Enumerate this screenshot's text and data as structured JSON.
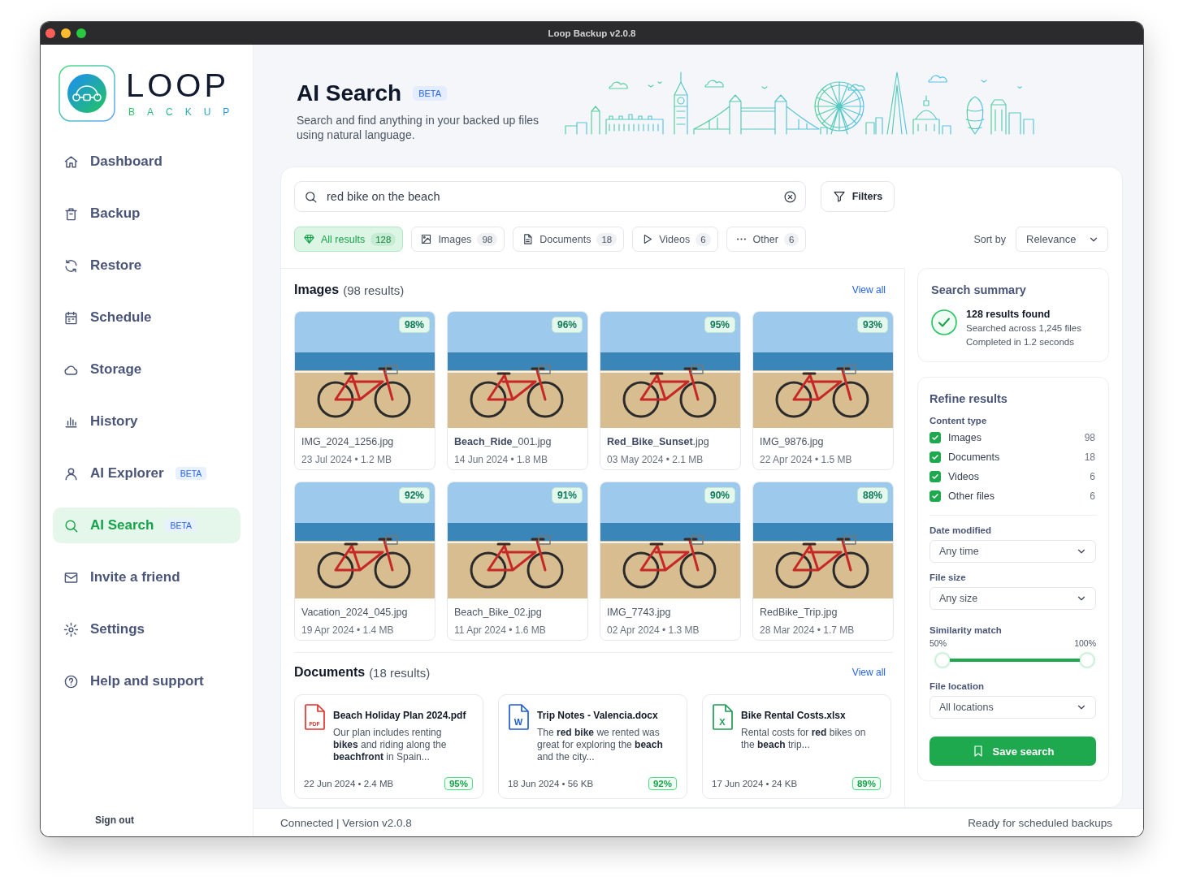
{
  "window": {
    "title": "Loop Backup v2.0.8"
  },
  "brand": {
    "name": "LOOP",
    "tagline": "BACKUP"
  },
  "sidebar": {
    "items": [
      {
        "label": "Dashboard",
        "selected": false
      },
      {
        "label": "Backup",
        "selected": false
      },
      {
        "label": "Restore",
        "selected": false
      },
      {
        "label": "Schedule",
        "selected": false
      },
      {
        "label": "Storage",
        "selected": false
      },
      {
        "label": "History",
        "selected": false
      },
      {
        "label": "AI Explorer",
        "badge": "BETA",
        "selected": false
      },
      {
        "label": "AI Search",
        "badge": "BETA",
        "selected": true
      },
      {
        "label": "Invite a friend",
        "selected": false
      },
      {
        "label": "Settings",
        "selected": false
      },
      {
        "label": "Help and support",
        "selected": false
      }
    ],
    "sign_out": "Sign out"
  },
  "header": {
    "title": "AI Search",
    "badge": "BETA",
    "subtitle": "Search and find anything in your backed up files using natural language."
  },
  "search": {
    "value": "red bike on the beach",
    "filters_button": "Filters"
  },
  "filter_tabs": [
    {
      "kind": "all",
      "label": "All results",
      "count": "128",
      "selected": true
    },
    {
      "kind": "images",
      "label": "Images",
      "count": "98",
      "selected": false
    },
    {
      "kind": "documents",
      "label": "Documents",
      "count": "18",
      "selected": false
    },
    {
      "kind": "videos",
      "label": "Videos",
      "count": "6",
      "selected": false
    },
    {
      "kind": "other",
      "label": "Other",
      "count": "6",
      "selected": false
    }
  ],
  "sort": {
    "label": "Sort by",
    "value": "Relevance"
  },
  "images": {
    "title": "Images",
    "count": "(98 results)",
    "view_all": "View all",
    "items": [
      {
        "name": "IMG_2024_1256.jpg",
        "meta": "23 Jul 2024 • 1.2 MB",
        "match": "98%"
      },
      {
        "name": "**Beach_Ride**_001.jpg",
        "meta": "14 Jun 2024 • 1.8 MB",
        "match": "96%"
      },
      {
        "name": "**Red_Bike_Sunset**.jpg",
        "meta": "03 May 2024 • 2.1 MB",
        "match": "95%"
      },
      {
        "name": "IMG_9876.jpg",
        "meta": "22 Apr 2024 • 1.5 MB",
        "match": "93%"
      },
      {
        "name": "Vacation_2024_045.jpg",
        "meta": "19 Apr 2024 • 1.4 MB",
        "match": "92%"
      },
      {
        "name": "Beach_Bike_02.jpg",
        "meta": "11 Apr 2024 • 1.6 MB",
        "match": "91%"
      },
      {
        "name": "IMG_7743.jpg",
        "meta": "02 Apr 2024 • 1.3 MB",
        "match": "90%"
      },
      {
        "name": "RedBike_Trip.jpg",
        "meta": "28 Mar 2024 • 1.7 MB",
        "match": "88%"
      }
    ]
  },
  "documents": {
    "title": "Documents",
    "count": "(18 results)",
    "view_all": "View all",
    "items": [
      {
        "kind": "pdf",
        "icon_text": "PDF",
        "name": "Beach Holiday Plan 2024.pdf",
        "excerpt": "Our plan includes renting **bikes** and riding along the **beachfront** in Spain...",
        "meta": "22 Jun 2024 • 2.4 MB",
        "match": "95%"
      },
      {
        "kind": "docx",
        "icon_text": "W",
        "name": "Trip Notes - Valencia.docx",
        "excerpt": "The **red bike** we rented was great for exploring the **beach** and the city...",
        "meta": "18 Jun 2024 • 56 KB",
        "match": "92%"
      },
      {
        "kind": "xlsx",
        "icon_text": "X",
        "name": "Bike Rental Costs.xlsx",
        "excerpt": "Rental costs for **red** bikes on the **beach** trip...",
        "meta": "17 Jun 2024 • 24 KB",
        "match": "89%"
      }
    ]
  },
  "summary": {
    "title": "Search summary",
    "headline": "128 results found",
    "lines": [
      "Searched across 1,245 files",
      "Completed in 1.2 seconds"
    ]
  },
  "refine": {
    "title": "Refine results",
    "content_type": {
      "label": "Content type",
      "options": [
        {
          "label": "Images",
          "count": "98",
          "checked": true
        },
        {
          "label": "Documents",
          "count": "18",
          "checked": true
        },
        {
          "label": "Videos",
          "count": "6",
          "checked": true
        },
        {
          "label": "Other files",
          "count": "6",
          "checked": true
        }
      ]
    },
    "selects": [
      {
        "label": "Date modified",
        "value": "Any time"
      },
      {
        "label": "File size",
        "value": "Any size"
      }
    ],
    "similarity": {
      "label": "Similarity match",
      "min_label": "50%",
      "max_label": "100%",
      "level": 1
    },
    "location": {
      "label": "File location",
      "value": "All locations"
    },
    "save_button": "Save search"
  },
  "status_bar": {
    "left": "Connected | Version v2.0.8",
    "right": "Ready for scheduled backups"
  }
}
